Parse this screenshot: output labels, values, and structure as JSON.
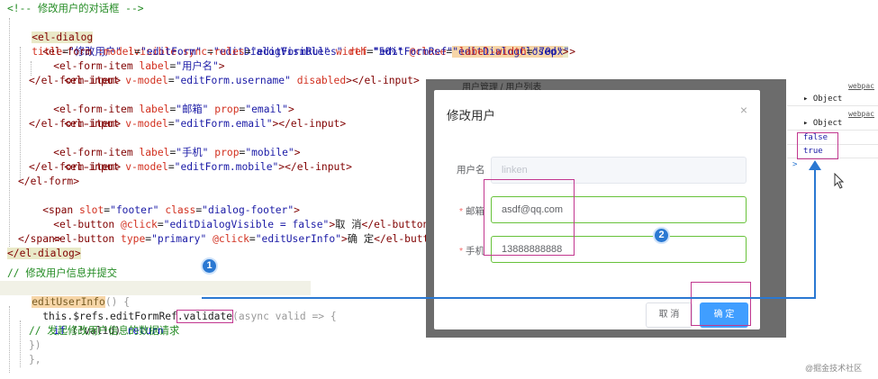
{
  "code": {
    "lines": [
      "<!-- 修改用户的对话框 -->",
      "<el-dialog title=\"修改用户\" :visible.sync=\"editDialogVisible\" width=\"50%\" @close=\"editDialogClosed\">",
      "<el-form :model=\"editForm\" :rules=\"editFormRules\" ref=\"editFormRef\" label-width=\"70px\">",
      "<el-form-item label=\"用户名\">",
      "<el-input v-model=\"editForm.username\" disabled></el-input>",
      "</el-form-item>",
      "<el-form-item label=\"邮箱\" prop=\"email\">",
      "<el-input v-model=\"editForm.email\"></el-input>",
      "</el-form-item>",
      "<el-form-item label=\"手机\" prop=\"mobile\">",
      "<el-input v-model=\"editForm.mobile\"></el-input>",
      "</el-form-item>",
      "</el-form>",
      "<span slot=\"footer\" class=\"dialog-footer\">",
      "<el-button @click=\"editDialogVisible = false\">取 消</el-button>",
      "<el-button type=\"primary\" @click=\"editUserInfo\">确 定</el-button>",
      "</span>",
      "</el-dialog>",
      "// 修改用户信息并提交",
      "editUserInfo() {",
      "this.$refs.editFormRef.validate(async valid => {",
      "if (!valid) return",
      "// 发起修改用户信息的数据请求",
      "})",
      "},"
    ]
  },
  "dialog": {
    "crumb": "用户管理  /  用户列表",
    "title": "修改用户",
    "close_icon": "×",
    "username_label": "用户名",
    "username_value": "linken",
    "email_label": "邮箱",
    "email_value": "asdf@qq.com",
    "mobile_label": "手机",
    "mobile_value": "13888888888",
    "required_mark": "*",
    "cancel_label": "取 消",
    "ok_label": "确 定"
  },
  "devtools": {
    "object_label": "Object",
    "link_text": "webpac",
    "false_value": "false",
    "true_value": "true",
    "prompt": ">"
  },
  "annotations": {
    "badge_1": "1",
    "badge_2": "2"
  },
  "watermark": "@掘金技术社区",
  "colors": {
    "highlight_box": "#c2378f",
    "annotation_blue": "#2a78d2",
    "primary_button": "#409eff",
    "valid_border": "#67c23a"
  }
}
